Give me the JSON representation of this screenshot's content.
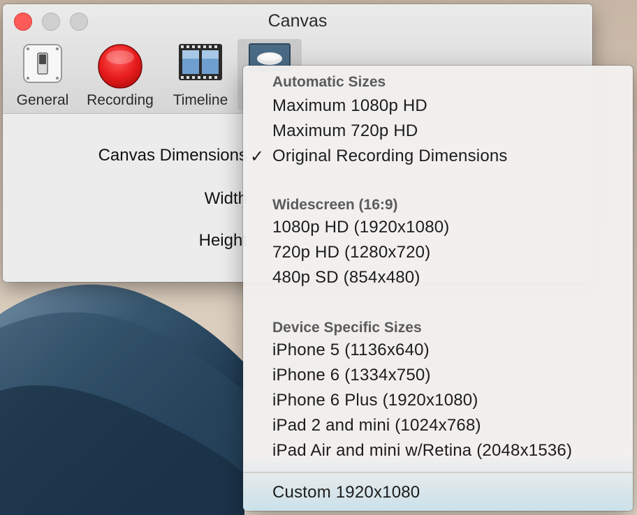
{
  "window": {
    "title": "Canvas",
    "toolbar": [
      {
        "label": "General",
        "icon": "toggle-switch-icon"
      },
      {
        "label": "Recording",
        "icon": "record-icon"
      },
      {
        "label": "Timeline",
        "icon": "film-strip-icon"
      },
      {
        "label": "",
        "icon": "canvas-icon",
        "selected": true
      }
    ],
    "form": {
      "canvas_dimensions_label": "Canvas Dimensions",
      "width_label": "Width",
      "height_label": "Height"
    }
  },
  "menu": {
    "sections": [
      {
        "header": "Automatic Sizes",
        "items": [
          {
            "label": "Maximum 1080p HD",
            "checked": false
          },
          {
            "label": "Maximum 720p HD",
            "checked": false
          },
          {
            "label": "Original Recording Dimensions",
            "checked": true
          }
        ]
      },
      {
        "header": "Widescreen (16:9)",
        "items": [
          {
            "label": "1080p HD (1920x1080)"
          },
          {
            "label": "720p HD (1280x720)"
          },
          {
            "label": "480p SD (854x480)"
          }
        ]
      },
      {
        "header": "Device Specific Sizes",
        "items": [
          {
            "label": "iPhone 5 (1136x640)"
          },
          {
            "label": "iPhone 6 (1334x750)"
          },
          {
            "label": "iPhone 6 Plus (1920x1080)"
          },
          {
            "label": "iPad 2 and mini (1024x768)"
          },
          {
            "label": "iPad Air and mini w/Retina (2048x1536)"
          }
        ]
      }
    ],
    "custom_item": "Custom 1920x1080",
    "check_glyph": "✓"
  },
  "colors": {
    "close": "#fc5b57",
    "record": "#e81c1c"
  }
}
